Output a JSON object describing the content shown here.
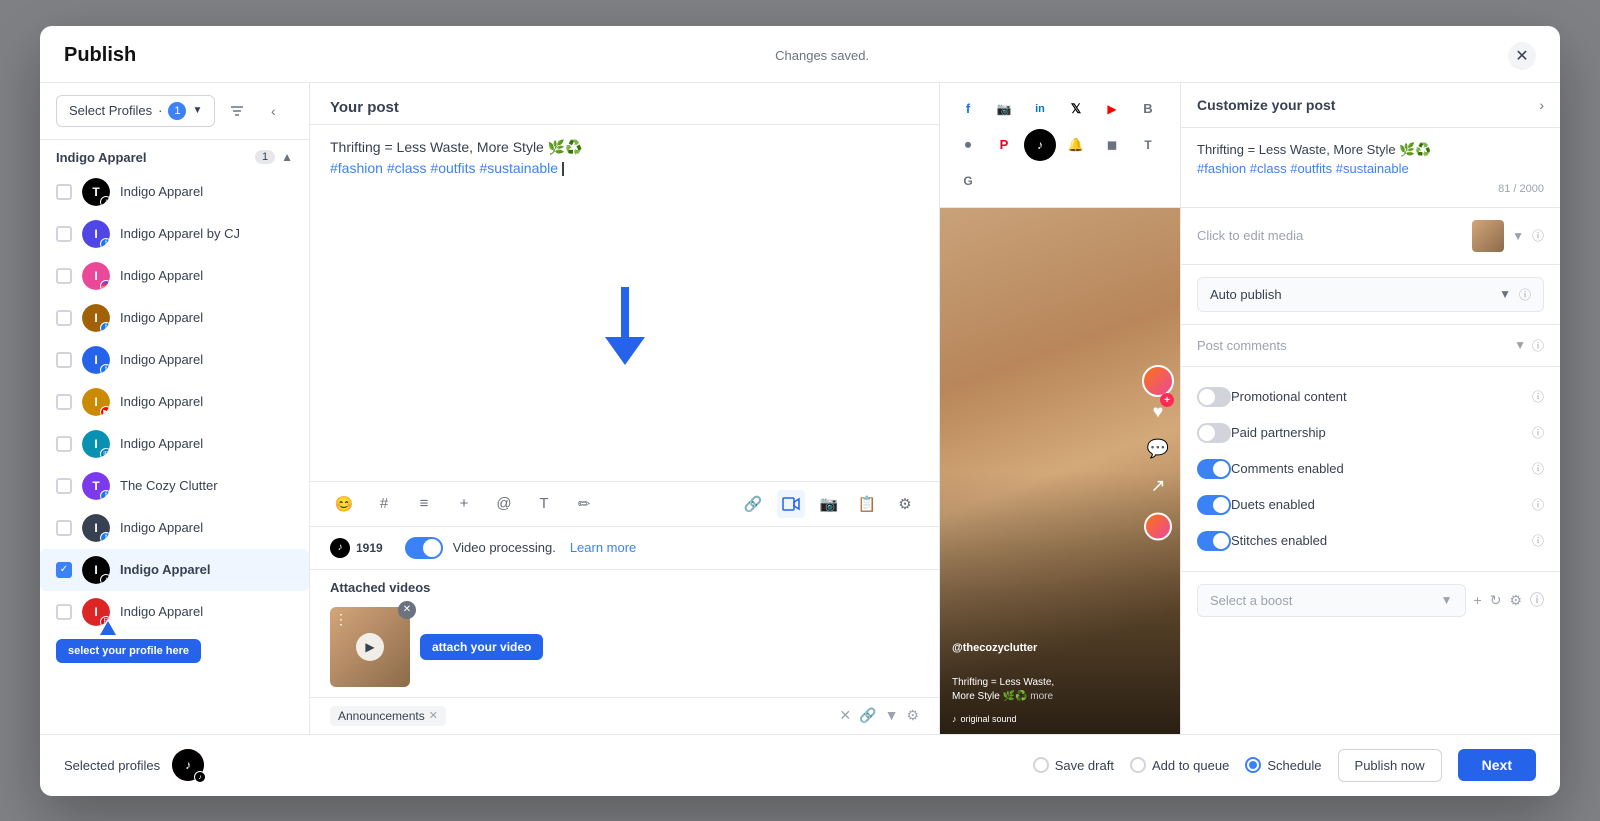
{
  "modal": {
    "title": "Publish",
    "changes_saved": "Changes saved.",
    "close_label": "✕"
  },
  "profiles_panel": {
    "select_profiles_label": "Select Profiles",
    "badge_count": "1",
    "group_name": "Indigo Apparel",
    "group_count": "1",
    "profiles": [
      {
        "name": "Indigo Apparel",
        "platform": "tiktok",
        "color": "#000",
        "checked": false
      },
      {
        "name": "Indigo Apparel by CJ",
        "platform": "facebook",
        "color": "#4f46e5",
        "checked": false
      },
      {
        "name": "Indigo Apparel",
        "platform": "instagram",
        "color": "#ec4899",
        "checked": false
      },
      {
        "name": "Indigo Apparel",
        "platform": "facebook",
        "color": "#a16207",
        "checked": false
      },
      {
        "name": "Indigo Apparel",
        "platform": "facebook",
        "color": "#2563eb",
        "checked": false
      },
      {
        "name": "Indigo Apparel",
        "platform": "youtube",
        "color": "#ca8a04",
        "checked": false
      },
      {
        "name": "Indigo Apparel",
        "platform": "linkedin",
        "color": "#0891b2",
        "checked": false
      },
      {
        "name": "The Cozy Clutter",
        "platform": "facebook",
        "color": "#7c3aed",
        "checked": false
      },
      {
        "name": "Indigo Apparel",
        "platform": "facebook",
        "color": "#374151",
        "checked": false
      },
      {
        "name": "Indigo Apparel",
        "platform": "tiktok",
        "color": "#000",
        "checked": true
      },
      {
        "name": "Indigo Apparel",
        "platform": "pinterest",
        "color": "#dc2626",
        "checked": false
      }
    ],
    "select_profile_tooltip": "select your profile here"
  },
  "post_panel": {
    "title": "Your post",
    "text_line1": "Thrifting = Less Waste, More Style 🌿♻️",
    "text_line2": "#fashion #class #outfits #sustainable",
    "video_toggle_text": "Video processing.",
    "learn_more": "Learn more",
    "attached_videos_label": "Attached videos",
    "attach_video_tooltip": "attach your video",
    "label_tag": "Announcements",
    "toolbar_icons": [
      "😊",
      "#",
      "≡",
      "+",
      "@",
      "T",
      "✏️"
    ],
    "toolbar_right_icons": [
      "🔗",
      "🎬",
      "📷",
      "📋",
      "⚙️"
    ]
  },
  "tiktok_num": "1919",
  "preview": {
    "user": "@thecozyclutter",
    "caption_line1": "Thrifting = Less Waste,",
    "caption_line2": "More Style 🌿♻️",
    "more": "more",
    "sound": "original sound",
    "platforms": [
      {
        "icon": "f",
        "label": "facebook",
        "active": false
      },
      {
        "icon": "📷",
        "label": "instagram",
        "active": false
      },
      {
        "icon": "in",
        "label": "linkedin",
        "active": false
      },
      {
        "icon": "𝕏",
        "label": "twitter",
        "active": false
      },
      {
        "icon": "▶",
        "label": "youtube",
        "active": false
      },
      {
        "icon": "B",
        "label": "buffer",
        "active": false
      },
      {
        "icon": "⏺",
        "label": "another",
        "active": false
      },
      {
        "icon": "P",
        "label": "pinterest",
        "active": false
      },
      {
        "icon": "T",
        "label": "tiktok",
        "active": true
      },
      {
        "icon": "N",
        "label": "notif",
        "active": false
      },
      {
        "icon": "◼",
        "label": "block",
        "active": false
      },
      {
        "icon": "T2",
        "label": "tumblr",
        "active": false
      },
      {
        "icon": "G",
        "label": "google",
        "active": false
      }
    ]
  },
  "customize": {
    "title": "Customize your post",
    "expand_icon": "›",
    "post_text_preview_1": "Thrifting = Less Waste, More Style 🌿♻️",
    "post_text_preview_2": "#fashion #class #outfits #sustainable",
    "char_count": "81 / 2000",
    "click_edit_media": "Click to edit media",
    "auto_publish_label": "Auto publish",
    "post_comments_label": "Post comments",
    "toggles": [
      {
        "label": "Promotional content",
        "state": "off"
      },
      {
        "label": "Paid partnership",
        "state": "off"
      },
      {
        "label": "Comments enabled",
        "state": "on"
      },
      {
        "label": "Duets enabled",
        "state": "on"
      },
      {
        "label": "Stitches enabled",
        "state": "on"
      }
    ],
    "select_boost_label": "Select a boost"
  },
  "footer": {
    "selected_profiles_label": "Selected profiles",
    "radio_options": [
      {
        "label": "Save draft",
        "selected": false
      },
      {
        "label": "Add to queue",
        "selected": false
      },
      {
        "label": "Schedule",
        "selected": true
      },
      {
        "label": "Publish now",
        "selected": false
      }
    ],
    "next_btn": "Next",
    "publish_now_btn": "Publish now"
  }
}
